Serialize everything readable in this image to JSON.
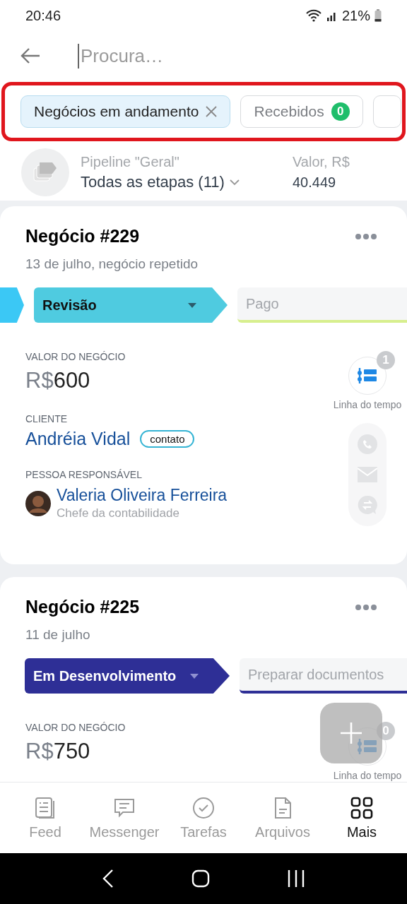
{
  "status_bar": {
    "time": "20:46",
    "battery": "21%"
  },
  "search": {
    "placeholder": "Procura…"
  },
  "filters": [
    {
      "label": "Negócios em andamento",
      "selected": true,
      "removable": true
    },
    {
      "label": "Recebidos",
      "selected": false,
      "count": "0"
    }
  ],
  "pipeline": {
    "label": "Pipeline \"Geral\"",
    "stages": "Todas as etapas (11)",
    "value_label": "Valor, R$",
    "value": "40.449"
  },
  "deals": [
    {
      "title": "Negócio #229",
      "subtitle": "13 de julho, negócio repetido",
      "previous_stage": {
        "color": "#3bc8f5"
      },
      "stage": {
        "label": "Revisão",
        "color": "#4fcbe0",
        "dark": false
      },
      "next_stage": {
        "label": "Pago",
        "color": "#d7ef8e"
      },
      "value_label": "VALOR DO NEGÓCIO",
      "currency": "R$",
      "amount": "600",
      "timeline_label": "Linha do tempo",
      "timeline_count": "1",
      "client_label": "CLIENTE",
      "client": "Andréia Vidal",
      "client_tag": "contato",
      "responsible_label": "PESSOA RESPONSÁVEL",
      "responsible_name": "Valeria Oliveira Ferreira",
      "responsible_role": "Chefe da contabilidade"
    },
    {
      "title": "Negócio #225",
      "subtitle": "11 de julho",
      "stage": {
        "label": "Em Desenvolvimento",
        "color": "#2e2f96",
        "dark": true
      },
      "next_stage": {
        "label": "Preparar documentos",
        "color": "#2e2f96"
      },
      "value_label": "VALOR DO NEGÓCIO",
      "currency": "R$",
      "amount": "750",
      "timeline_label": "Linha do tempo",
      "timeline_count": "0"
    }
  ],
  "nav": [
    {
      "label": "Feed",
      "kind": "feed",
      "selected": false
    },
    {
      "label": "Messenger",
      "kind": "chat",
      "selected": false
    },
    {
      "label": "Tarefas",
      "kind": "tasks",
      "selected": false
    },
    {
      "label": "Arquivos",
      "kind": "files",
      "selected": false
    },
    {
      "label": "Mais",
      "kind": "more",
      "selected": true
    }
  ]
}
